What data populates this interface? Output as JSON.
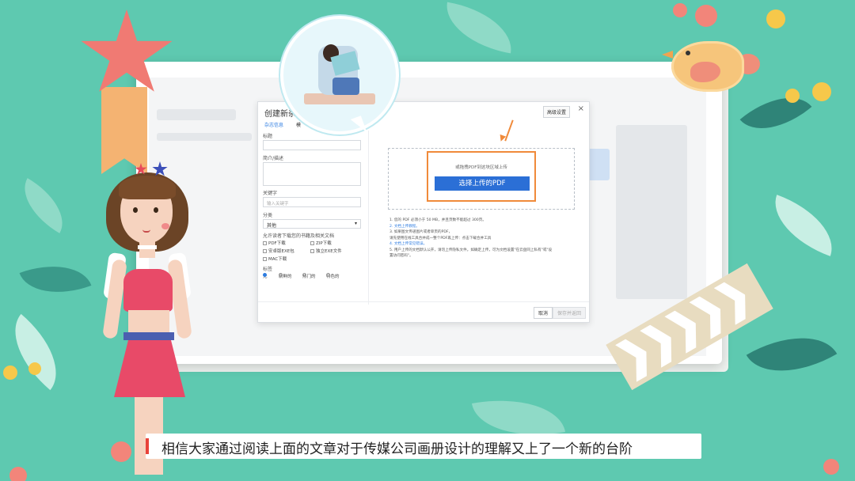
{
  "colors": {
    "background": "#5ec9b0",
    "accent_orange": "#f08a3a",
    "primary_blue": "#2b6fd6",
    "subtitle_accent": "#e8433a"
  },
  "dialog": {
    "title": "创建新杂",
    "advanced_label": "高级设置",
    "close_icon": "close-icon",
    "tabs": [
      "杂志信息",
      "模"
    ],
    "fields": {
      "title_label": "标题",
      "description_label": "简介/描述",
      "keywords_label": "关键字",
      "keywords_placeholder": "输入关键字",
      "category_label": "分类",
      "category_value": "其他",
      "allow_download_label": "允许读者下载您的书籍及相关文档",
      "checkboxes": [
        "PDF下载",
        "ZIP下载",
        "安卓版EXE包",
        "独立EXE文件",
        "MAC下载"
      ],
      "tags_label": "标签",
      "radio_options": [
        "无",
        "新鲜的",
        "热门的",
        "特色的"
      ]
    },
    "upload": {
      "hint": "或拖拽PDF到这块区域上传",
      "button_label": "选择上传的PDF"
    },
    "notes": [
      "1. 您的 PDF 必须小于 50 MB，并且页数不能超过 300页。",
      "2. 文档上传教程。",
      "3. 如果图文传递图片或者单页的PDF，",
      "   请先使用在线工具合并成一整个PDF再上传：点击下载合并工具",
      "4. 文档上传常见错误。",
      "5. 用户上传的文档默认公开，请勿上传隐私文件。如确定上传，可为文档设置\"在云盘同上私有\"或\"设",
      "   置访问密码\"。"
    ],
    "cancel_label": "取消",
    "save_label": "保存并返回"
  },
  "subtitle": "相信大家通过阅读上面的文章对于传媒公司画册设计的理解又上了一个新的台阶"
}
